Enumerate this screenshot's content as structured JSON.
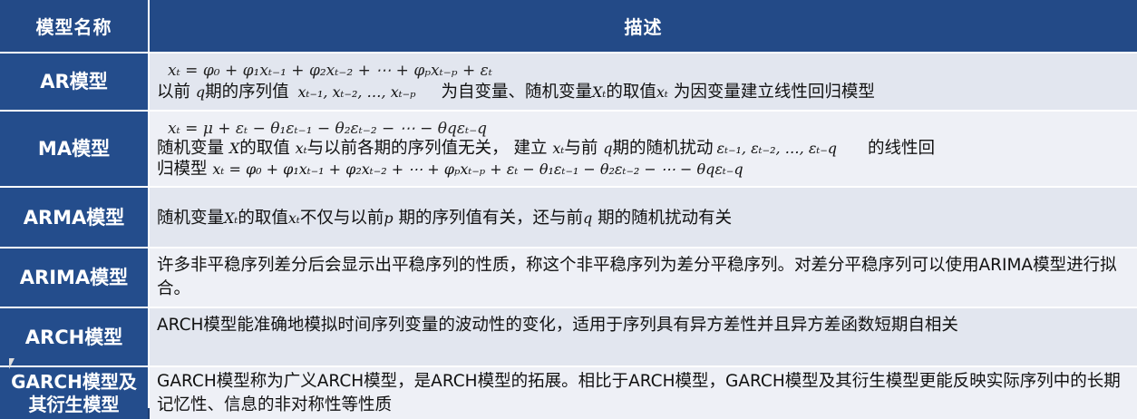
{
  "header": {
    "col_name": "模型名称",
    "col_desc": "描述"
  },
  "rows": [
    {
      "name": "AR模型",
      "formula": "xₜ = φ₀ + φ₁xₜ₋₁ + φ₂xₜ₋₂ + ⋯ + φₚxₜ₋ₚ + εₜ",
      "text_a": "以前 ",
      "sym_q": "q",
      "text_b": "期的序列值 ",
      "sym_series": "xₜ₋₁, xₜ₋₂, …, xₜ₋ₚ",
      "text_c": "为自变量、随机变量",
      "sym_X": "Xₜ",
      "text_d": "的取值",
      "sym_x": "xₜ",
      "text_e": "为因变量建立线性回归模型"
    },
    {
      "name": "MA模型",
      "formula": "xₜ = μ + εₜ − θ₁εₜ₋₁ − θ₂εₜ₋₂ − ⋯ − θqεₜ₋q",
      "text_a": "随机变量 ",
      "sym_X": "X",
      "text_b": "的取值 ",
      "sym_x": "xₜ",
      "text_c": "与以前各期的序列值无关，  建立 ",
      "sym_x2": "xₜ",
      "text_d": "与前 ",
      "sym_q": "q",
      "text_e": "期的随机扰动",
      "sym_eps": "εₜ₋₁, εₜ₋₂, …, εₜ₋q",
      "text_f": "的线性回",
      "text_g": "归模型 ",
      "formula2": "xₜ = φ₀ + φ₁xₜ₋₁ + φ₂xₜ₋₂ + ⋯ + φₚxₜ₋ₚ + εₜ − θ₁εₜ₋₁ − θ₂εₜ₋₂ − ⋯ − θqεₜ₋q"
    },
    {
      "name": "ARMA模型",
      "text_a": "随机变量",
      "sym_X": "Xₜ",
      "text_b": "的取值",
      "sym_x": "xₜ",
      "text_c": "不仅与以前",
      "sym_p": "p",
      "text_d": " 期的序列值有关，还与前",
      "sym_q": "q",
      "text_e": " 期的随机扰动有关"
    },
    {
      "name": "ARIMA模型",
      "desc": "许多非平稳序列差分后会显示出平稳序列的性质，称这个非平稳序列为差分平稳序列。对差分平稳序列可以使用ARIMA模型进行拟合。"
    },
    {
      "name": "ARCH模型",
      "desc": "ARCH模型能准确地模拟时间序列变量的波动性的变化，适用于序列具有异方差性并且异方差函数短期自相关"
    },
    {
      "name": "GARCH模型及其衍生模型",
      "desc": "GARCH模型称为广义ARCH模型，是ARCH模型的拓展。相比于ARCH模型，GARCH模型及其衍生模型更能反映实际序列中的长期记忆性、信息的非对称性等性质"
    }
  ]
}
